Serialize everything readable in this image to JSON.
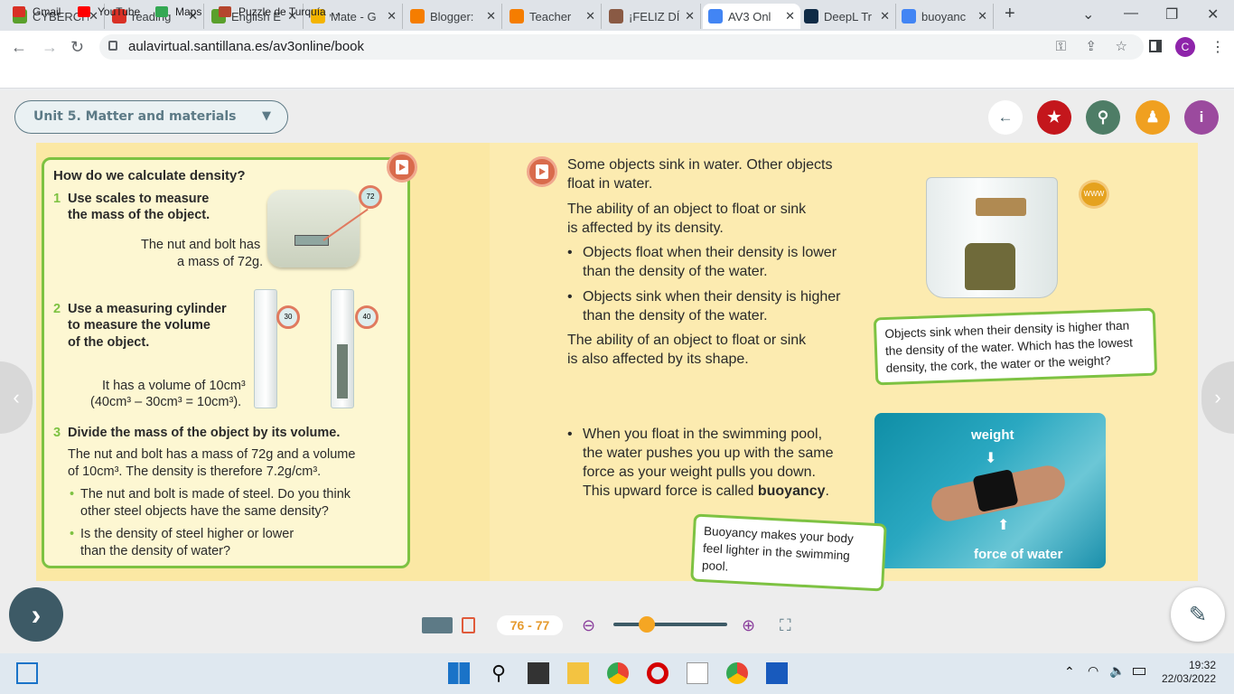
{
  "tabs": [
    {
      "label": "CYBERCH",
      "icon": "isl-icon",
      "color": "#5aa02c"
    },
    {
      "label": "reading",
      "icon": "gmail-icon",
      "color": "#d93025"
    },
    {
      "label": "English E",
      "icon": "isl-icon",
      "color": "#5aa02c"
    },
    {
      "label": "Mate - G",
      "icon": "drive-icon",
      "color": "#f4b400"
    },
    {
      "label": "Blogger:",
      "icon": "blogger-icon",
      "color": "#f57d00"
    },
    {
      "label": "Teacher",
      "icon": "blogger-icon",
      "color": "#f57d00"
    },
    {
      "label": "¡FELIZ DÍ",
      "icon": "image-icon",
      "color": "#8a5a44"
    },
    {
      "label": "AV3 Onl",
      "icon": "chrome-icon",
      "color": "#4285f4"
    },
    {
      "label": "DeepL Tr",
      "icon": "deepl-icon",
      "color": "#0f2b46"
    },
    {
      "label": "buoyanc",
      "icon": "google-icon",
      "color": "#4285f4"
    }
  ],
  "address": {
    "url": "aulavirtual.santillana.es/av3online/book",
    "profile": "C"
  },
  "bookmarks": [
    {
      "label": "Gmail",
      "icon": "gmail-icon",
      "color": "#d93025"
    },
    {
      "label": "YouTube",
      "icon": "youtube-icon",
      "color": "#ff0000"
    },
    {
      "label": "Maps",
      "icon": "maps-icon",
      "color": "#34a853"
    },
    {
      "label": "Puzzle de Turquía ,...",
      "icon": "puzzle-icon",
      "color": "#b5462e"
    }
  ],
  "unit": {
    "title": "Unit 5. Matter and materials"
  },
  "left": {
    "heading": "How do we calculate density?",
    "step1_num": "1",
    "step1": "Use scales to measure",
    "step1b": "the mass of the object.",
    "mass_note1": "The nut and bolt has",
    "mass_note2": "a mass of 72g.",
    "step2_num": "2",
    "step2a": "Use a measuring cylinder",
    "step2b": "to measure the volume",
    "step2c": "of the object.",
    "vol_note1": "It has a volume of 10cm³",
    "vol_note2": "(40cm³ – 30cm³ = 10cm³).",
    "step3_num": "3",
    "step3": "Divide the mass of the object by its volume.",
    "p1": "The nut and bolt has a mass of 72g and a volume",
    "p2": "of 10cm³. The density is therefore 7.2g/cm³.",
    "q1a": "The nut and bolt is made of steel. Do you think",
    "q1b": "other steel objects have the same density?",
    "q2a": "Is the density of steel higher or lower",
    "q2b": "than the density of water?",
    "scale_reading": "72",
    "cyl1_reading": "30",
    "cyl2_reading": "40"
  },
  "right": {
    "intro1": "Some objects sink in water. Other objects",
    "intro2": "float in water.",
    "ability1": "The ability of an object to float or sink",
    "ability2": "is affected by its density.",
    "b1a": "Objects float when their density is lower",
    "b1b": "than the density of the water.",
    "b2a": "Objects sink when their density is higher",
    "b2b": "than the density of the water.",
    "shape1": "The ability of an object to float or sink",
    "shape2": "is also affected by its shape.",
    "pool1": "When you float in the swimming pool,",
    "pool2": "the water pushes you up with the same",
    "pool3": "force as your weight pulls you down.",
    "pool4pre": "This upward force is called ",
    "pool4b": "buoyancy",
    "pool4post": ".",
    "cap1": "Objects sink when their density is higher than the density of the water. Which has the lowest density, the cork, the water or the weight?",
    "cap2": "Buoyancy makes your body feel lighter in the swimming pool.",
    "weight_label": "weight",
    "force_label": "force of water",
    "www": "WWW"
  },
  "pager": {
    "pages": "76 - 77"
  },
  "clock": {
    "time": "19:32",
    "date": "22/03/2022"
  }
}
